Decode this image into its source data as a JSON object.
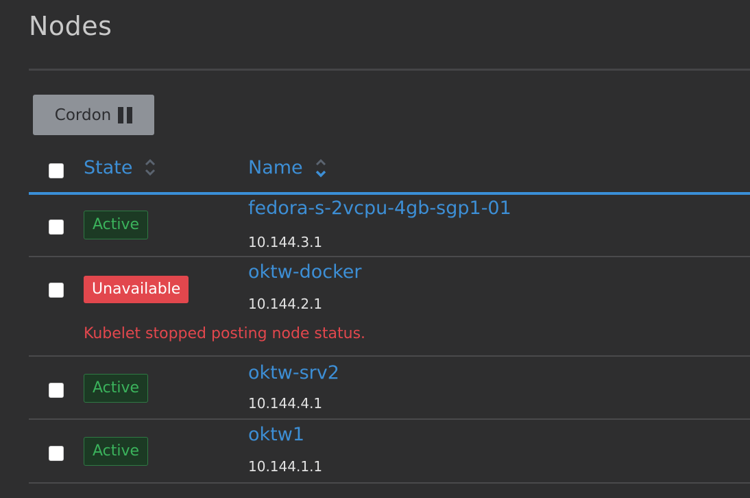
{
  "page": {
    "title": "Nodes"
  },
  "toolbar": {
    "cordon_label": "Cordon",
    "cordon_icon": "pause-icon"
  },
  "table": {
    "columns": [
      {
        "label": "State",
        "sort_icon": "sort-icon"
      },
      {
        "label": "Name",
        "sort_icon": "sort-icon"
      }
    ],
    "rows": [
      {
        "state": "Active",
        "name": "fedora-s-2vcpu-4gb-sgp1-01",
        "ip": "10.144.3.1",
        "error": ""
      },
      {
        "state": "Unavailable",
        "name": "oktw-docker",
        "ip": "10.144.2.1",
        "error": "Kubelet stopped posting node status."
      },
      {
        "state": "Active",
        "name": "oktw-srv2",
        "ip": "10.144.4.1",
        "error": ""
      },
      {
        "state": "Active",
        "name": "oktw1",
        "ip": "10.144.1.1",
        "error": ""
      }
    ]
  },
  "colors": {
    "background": "#2e2e2f",
    "accent": "#3d8fd6",
    "active": "#3bb35c",
    "unavailable": "#e2474d",
    "button": "#8e9298"
  }
}
